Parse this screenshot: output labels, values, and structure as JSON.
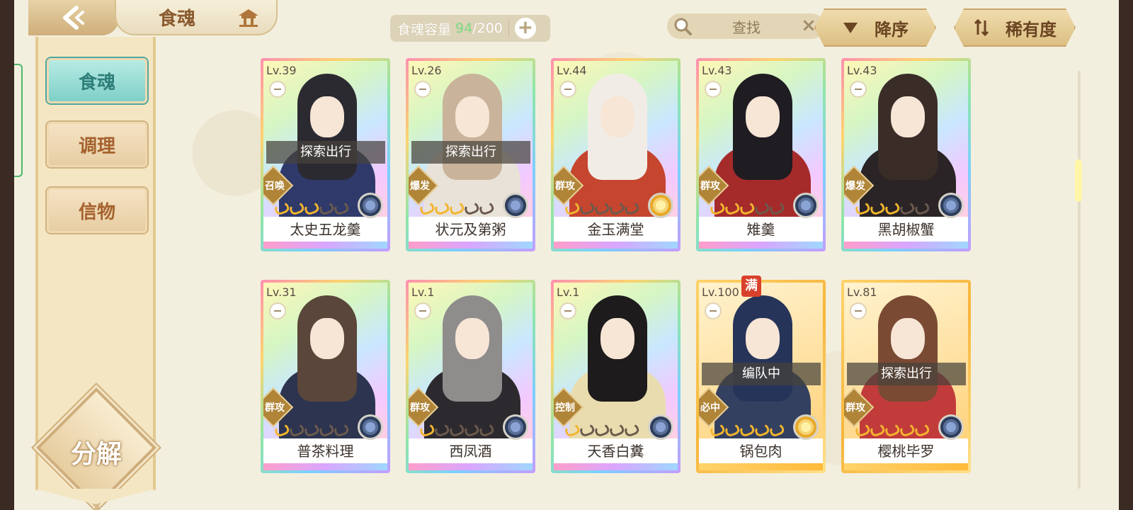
{
  "header": {
    "title": "食魂",
    "capacity_label": "食魂容量",
    "capacity_current": "94",
    "capacity_max": "/200",
    "search_placeholder": "查找",
    "sort_order_label": "降序",
    "sort_field_label": "稀有度"
  },
  "sidebar": {
    "tabs": [
      {
        "label": "食魂"
      },
      {
        "label": "调理"
      },
      {
        "label": "信物"
      }
    ],
    "decompose_label": "分解"
  },
  "cards": [
    {
      "level": "Lv.39",
      "name": "太史五龙羹",
      "role": "召唤",
      "status": "探索出行",
      "stars": 3,
      "emblem": "blue",
      "frame": "rainbow",
      "hair": "#2c2a31",
      "outfit": "#2f3a6b"
    },
    {
      "level": "Lv.26",
      "name": "状元及第粥",
      "role": "爆发",
      "status": "探索出行",
      "stars": 3,
      "emblem": "blue",
      "frame": "rainbow",
      "hair": "#c9b39a",
      "outfit": "#e8e2d8"
    },
    {
      "level": "Lv.44",
      "name": "金玉满堂",
      "role": "群攻",
      "status": "",
      "stars": 1,
      "emblem": "gold",
      "frame": "rainbow",
      "hair": "#f1ede6",
      "outfit": "#c6452e"
    },
    {
      "level": "Lv.43",
      "name": "雉羹",
      "role": "群攻",
      "status": "",
      "stars": 3,
      "emblem": "blue",
      "frame": "rainbow",
      "hair": "#1f1c22",
      "outfit": "#a52b2b"
    },
    {
      "level": "Lv.43",
      "name": "黑胡椒蟹",
      "role": "爆发",
      "status": "",
      "stars": 3,
      "emblem": "blue",
      "frame": "rainbow",
      "hair": "#3a2d28",
      "outfit": "#2a2426"
    },
    {
      "level": "Lv.31",
      "name": "普茶料理",
      "role": "群攻",
      "status": "",
      "stars": 1,
      "emblem": "blue",
      "frame": "rainbow",
      "hair": "#5a463a",
      "outfit": "#2d3450"
    },
    {
      "level": "Lv.1",
      "name": "西凤酒",
      "role": "群攻",
      "status": "",
      "stars": 1,
      "emblem": "blue",
      "frame": "rainbow",
      "hair": "#8f8c8c",
      "outfit": "#2c2a2e"
    },
    {
      "level": "Lv.1",
      "name": "天香白糞",
      "role": "控制",
      "status": "",
      "stars": 1,
      "emblem": "blue",
      "frame": "rainbow",
      "hair": "#1e1b1c",
      "outfit": "#e9ddb0"
    },
    {
      "level": "Lv.100",
      "name": "锅包肉",
      "role": "必中",
      "status": "编队中",
      "stars": 5,
      "emblem": "gold",
      "frame": "gold",
      "hair": "#27345a",
      "outfit": "#34405f",
      "max_badge": "满"
    },
    {
      "level": "Lv.81",
      "name": "樱桃毕罗",
      "role": "群攻",
      "status": "探索出行",
      "stars": 5,
      "emblem": "blue",
      "frame": "gold",
      "hair": "#7a4a33",
      "outfit": "#c23b3b"
    }
  ]
}
